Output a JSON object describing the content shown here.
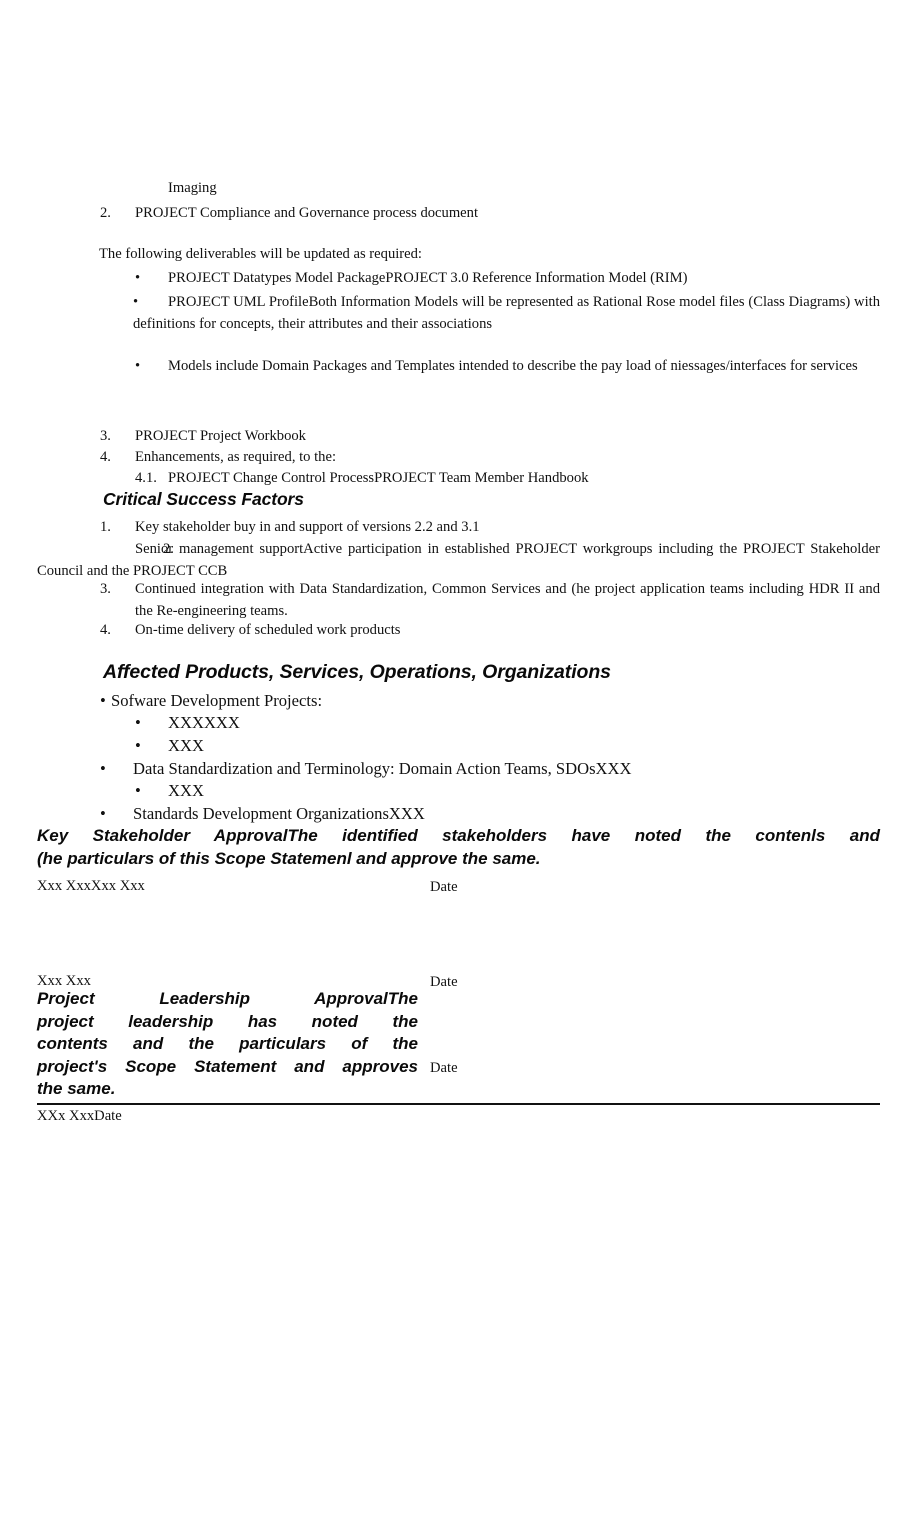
{
  "document": {
    "deliverables_tail": {
      "imaging": "Imaging",
      "item2_number": "2.",
      "item2_text": "PROJECT Compliance and Governance process document"
    },
    "updated_deliverables": {
      "lead_in": "The following deliverables will be updated as required:",
      "bullet_glyph": "•",
      "items": [
        "PROJECT Datatypes Model PackagePROJECT 3.0 Reference Information Model (RIM)",
        "PROJECT UML ProfileBoth Information Models will be represented as Rational Rose model files (Class Diagrams) with definitions for concepts, their attributes and their associations",
        "Models include Domain Packages and Templates intended to describe the pay load of niessages/interfaces for services"
      ]
    },
    "numbered_continued": [
      {
        "number": "3.",
        "text": "PROJECT Project Workbook"
      },
      {
        "number": "4.",
        "text": "Enhancements, as required, to the:"
      }
    ],
    "sub_numbered": {
      "number": "4.1.",
      "text": "PROJECT Change Control ProcessPROJECT Team Member Handbook"
    },
    "critical_success_factors": {
      "heading": "Critical Success Factors",
      "items": [
        {
          "number": "1.",
          "text": "Key stakeholder buy in and support of versions 2.2 and 3.1"
        },
        {
          "number": "2.",
          "text": "Senior management supportActive participation in established PROJECT workgroups including the PROJECT Stakeholder Council and the PROJECT CCB"
        },
        {
          "number": "3.",
          "text": "Continued integration with Data Standardization, Common Services and (he project application teams including HDR II and the Re-engineering teams."
        },
        {
          "number": "4.",
          "text": "On-time delivery of scheduled work products"
        }
      ]
    },
    "affected": {
      "heading": "Affected Products, Services, Operations, Organizations",
      "bullet_glyph": "•",
      "items": [
        {
          "level": 1,
          "text": "Sofware Development Projects:"
        },
        {
          "level": 2,
          "text": "XXXXXX"
        },
        {
          "level": 2,
          "text": "XXX"
        },
        {
          "level": 1,
          "text": "Data Standardization and Terminology: Domain Action Teams, SDOsXXX"
        },
        {
          "level": 2,
          "text": "XXX"
        },
        {
          "level": 1,
          "text": "Standards Development OrganizationsXXX"
        }
      ]
    },
    "key_stakeholder_approval": {
      "paragraph_line1": "Key Stakeholder ApprovalThe identified stakeholders have noted the contenls and",
      "paragraph_line2": "(he particulars of this Scope Statemenl and approve the same.",
      "signature_name_1": "Xxx XxxXxx Xxx",
      "date_label_1": "Date",
      "signature_name_2": "Xxx Xxx",
      "date_label_2": "Date"
    },
    "project_leadership_approval": {
      "line1": "Project Leadership ApprovalThe",
      "line2": "project leadership has noted the",
      "line3": "contents and the particulars of the",
      "line4": "project's Scope Statement and approves",
      "line5": "the same.",
      "date_label_3": "Date",
      "footer_line": "XXx XxxDate"
    }
  }
}
